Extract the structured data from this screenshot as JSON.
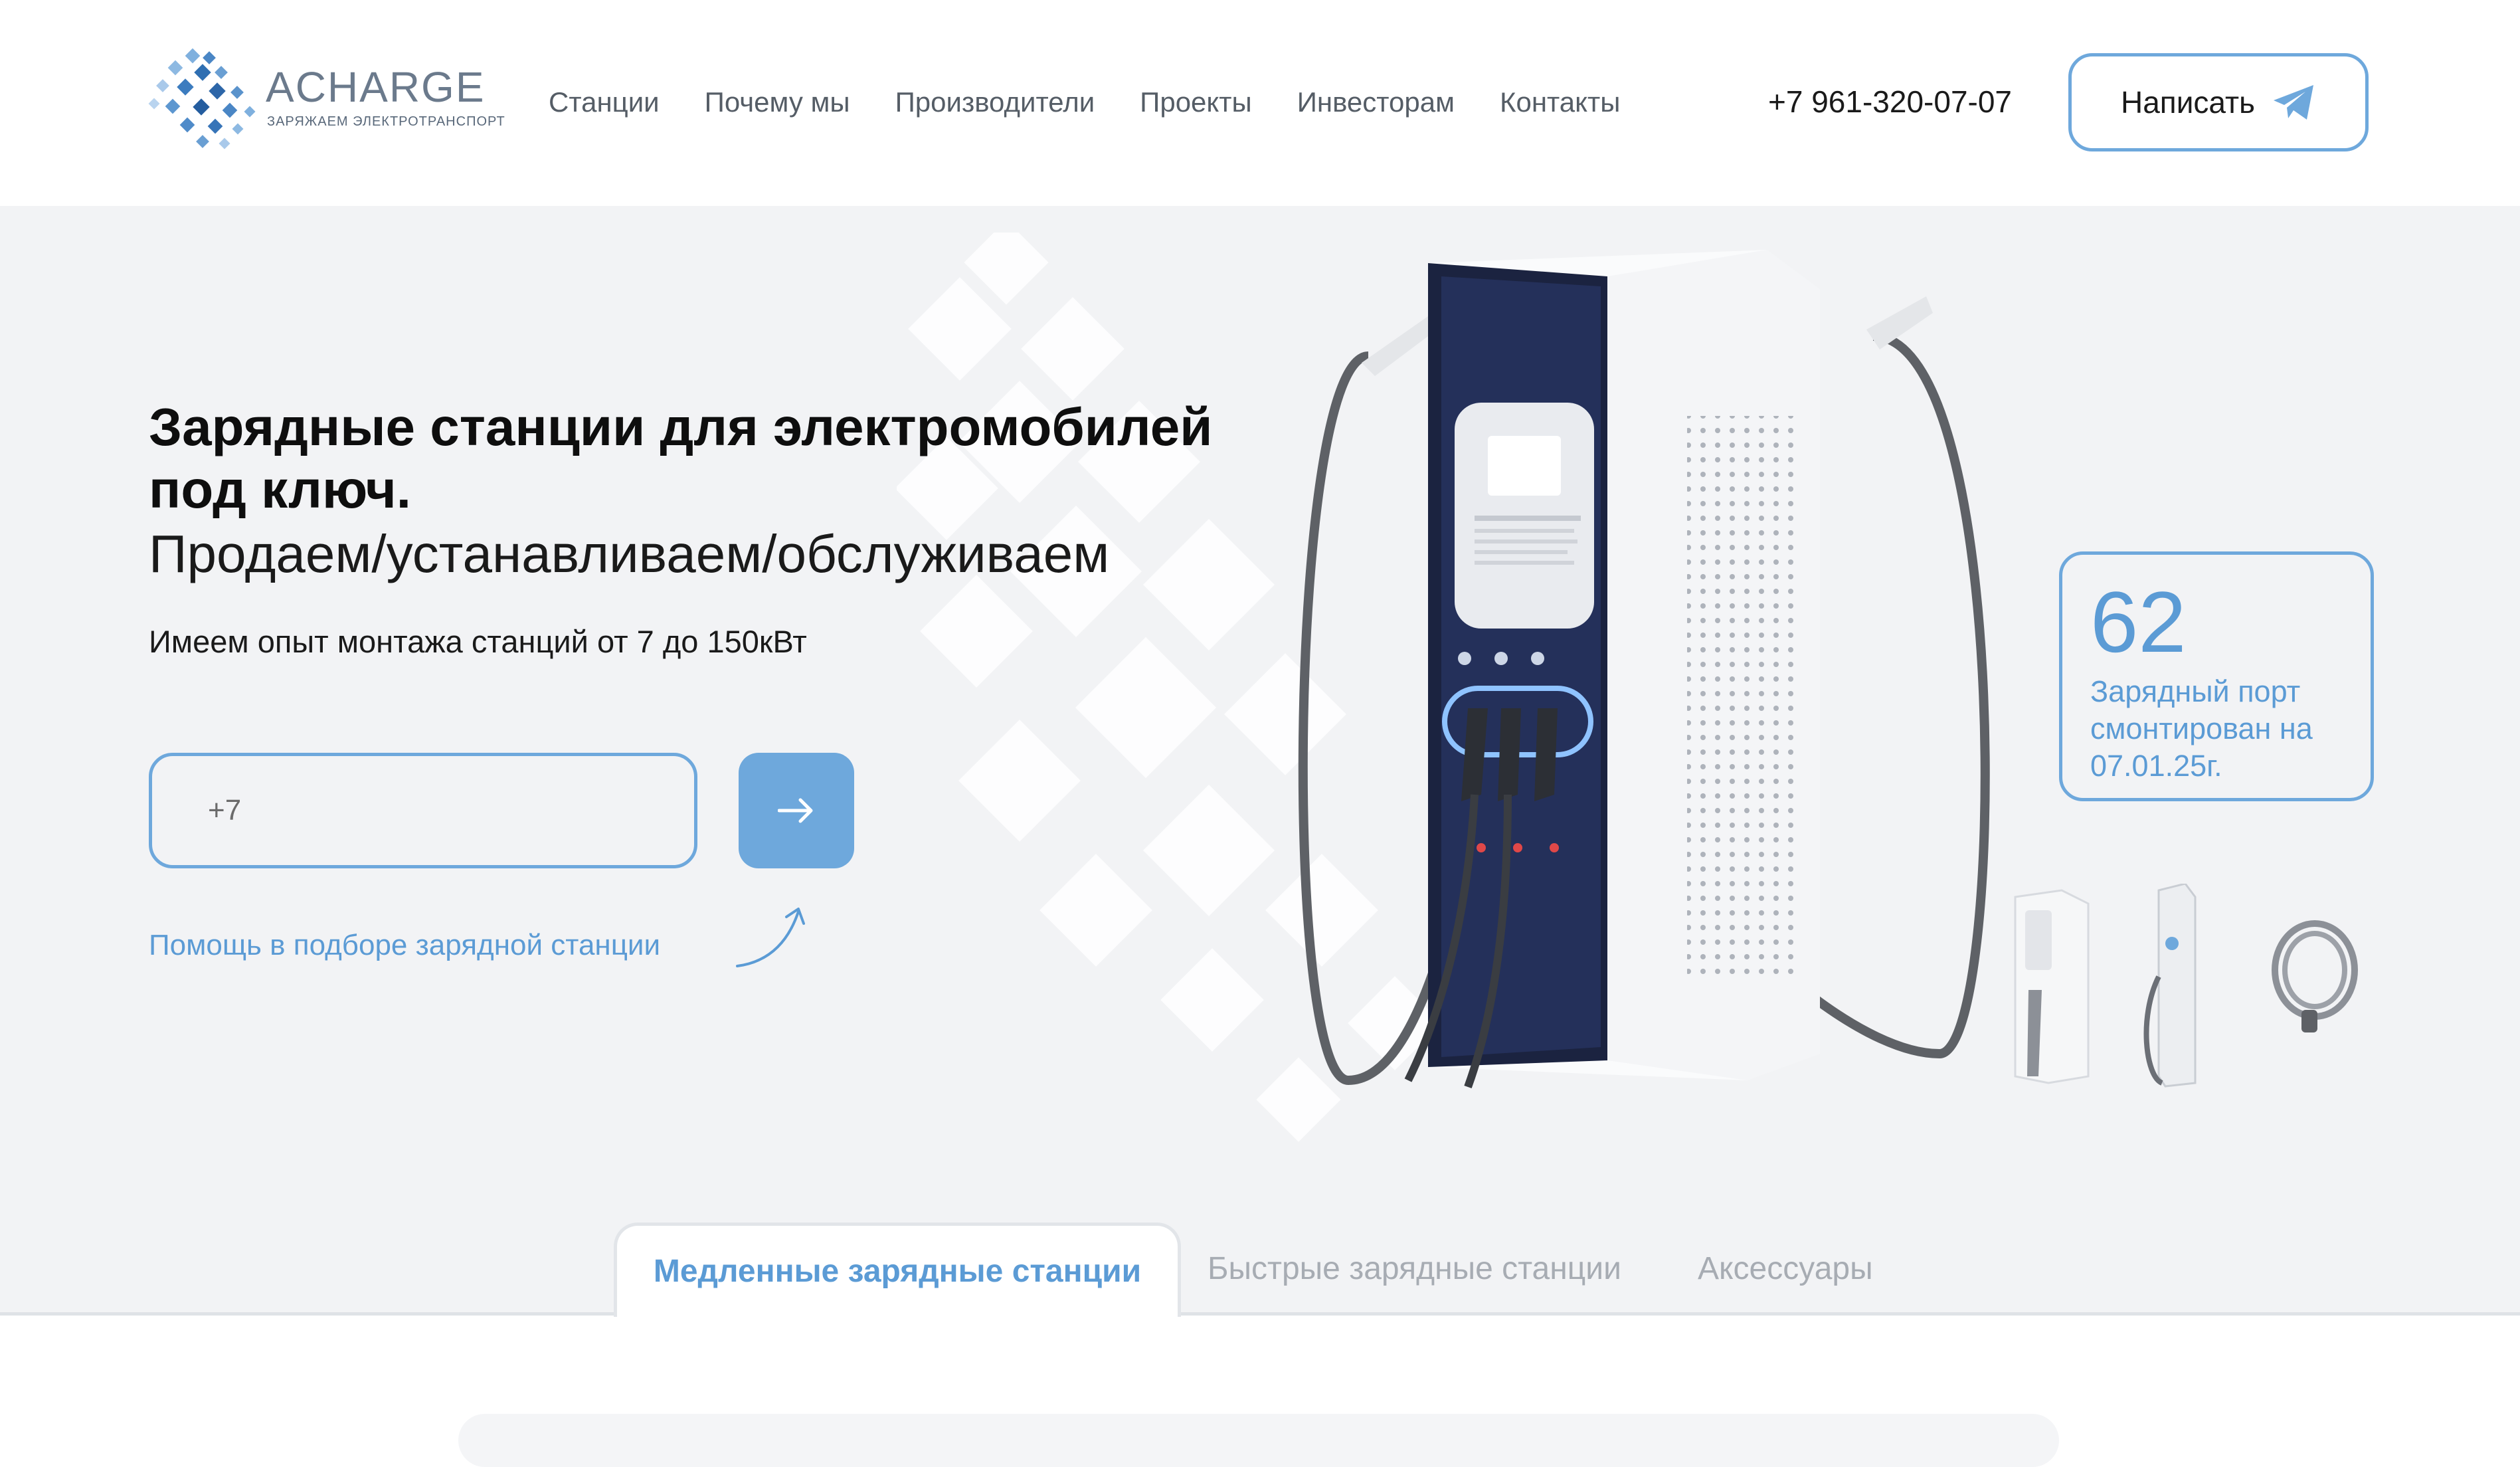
{
  "header": {
    "logo": {
      "name": "ACHARGE",
      "tagline": "ЗАРЯЖАЕМ ЭЛЕКТРОТРАНСПОРТ"
    },
    "nav": [
      {
        "label": "Станции"
      },
      {
        "label": "Почему мы"
      },
      {
        "label": "Производители"
      },
      {
        "label": "Проекты"
      },
      {
        "label": "Инвесторам"
      },
      {
        "label": "Контакты"
      }
    ],
    "phone": "+7 961-320-07-07",
    "write_button": {
      "label": "Написать",
      "icon": "telegram-icon"
    }
  },
  "hero": {
    "title": "Зарядные станции для электромобилей под ключ.",
    "subtitle": "Продаем/устанавливаем/обслуживаем",
    "description": "Имеем опыт монтажа станций от 7 до 150кВт",
    "phone_input": {
      "placeholder": "+7"
    },
    "submit_icon": "arrow-right-icon",
    "help_link": "Помощь в подборе зарядной станции",
    "stat": {
      "number": "62",
      "text": "Зарядный порт смонтирован на 07.01.25г."
    }
  },
  "tabs": [
    {
      "label": "Медленные зарядные станции",
      "active": true
    },
    {
      "label": "Быстрые зарядные станции",
      "active": false
    },
    {
      "label": "Аксессуары",
      "active": false
    }
  ],
  "colors": {
    "accent": "#6ea8dc",
    "accent_text": "#5b9bd5",
    "hero_bg": "#f2f3f5"
  }
}
